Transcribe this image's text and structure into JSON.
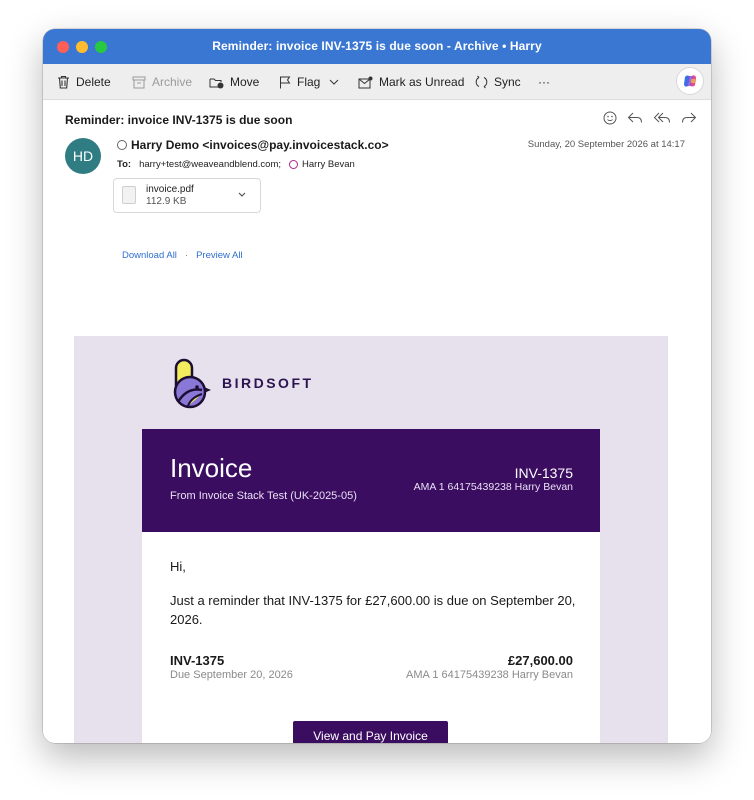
{
  "window": {
    "title": "Reminder: invoice INV-1375 is due soon - Archive • Harry"
  },
  "toolbar": {
    "delete": "Delete",
    "archive": "Archive",
    "move": "Move",
    "flag": "Flag",
    "mark_unread": "Mark as Unread",
    "sync": "Sync",
    "more": "···"
  },
  "message": {
    "subject": "Reminder: invoice INV-1375 is due soon",
    "avatar_initials": "HD",
    "from": "Harry Demo <invoices@pay.invoicestack.co>",
    "date": "Sunday, 20 September 2026 at 14:17",
    "to_label": "To:",
    "to_address": "harry+test@weaveandblend.com;",
    "to_contact": "Harry Bevan"
  },
  "attachment": {
    "name": "invoice.pdf",
    "size": "112.9 KB",
    "download_all": "Download All",
    "separator": "·",
    "preview_all": "Preview All"
  },
  "email_body": {
    "brand": "BIRDSOFT",
    "invoice_title": "Invoice",
    "from_line": "From Invoice Stack Test (UK-2025-05)",
    "invoice_number": "INV-1375",
    "reference": "AMA 1 64175439238 Harry Bevan",
    "greeting": "Hi,",
    "message": "Just a reminder that INV-1375 for £27,600.00 is due on September 20, 2026.",
    "summary_number": "INV-1375",
    "summary_amount": "£27,600.00",
    "summary_due": "Due September 20, 2026",
    "summary_reference": "AMA 1 64175439238 Harry Bevan",
    "pay_button": "View and Pay Invoice"
  },
  "colors": {
    "titlebar": "#3a77d3",
    "invoice_purple": "#3b0d61",
    "body_background": "#e7e1ee",
    "avatar": "#2f7d82",
    "link": "#2f6fd0"
  }
}
